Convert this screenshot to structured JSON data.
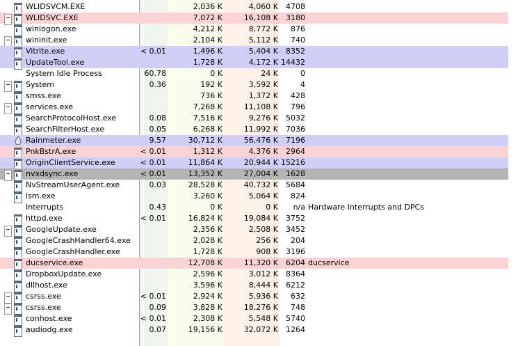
{
  "colors": {
    "highlight_pink": "#fbd3d6",
    "highlight_blue": "#cfcff8",
    "highlight_selected": "#b4b4b4",
    "cpu_column": "#eef6ee",
    "private_column": "#fcfcee",
    "working_set_column": "#fdf1ea"
  },
  "processes": [
    {
      "name": "WLIDSVCM.EXE",
      "cpu": "",
      "private": "2,036 K",
      "working_set": "4,060 K",
      "pid": "4708",
      "description": "",
      "tree": false,
      "icon": "window-icon",
      "highlight": ""
    },
    {
      "name": "WLIDSVC.EXE",
      "cpu": "",
      "private": "7,072 K",
      "working_set": "16,108 K",
      "pid": "3180",
      "description": "",
      "tree": true,
      "icon": "window-icon",
      "highlight": "pink"
    },
    {
      "name": "winlogon.exe",
      "cpu": "",
      "private": "4,212 K",
      "working_set": "8,772 K",
      "pid": "876",
      "description": "",
      "tree": false,
      "icon": "window-icon",
      "highlight": ""
    },
    {
      "name": "wininit.exe",
      "cpu": "",
      "private": "2,104 K",
      "working_set": "5,112 K",
      "pid": "740",
      "description": "",
      "tree": true,
      "icon": "window-icon",
      "highlight": ""
    },
    {
      "name": "Vitrite.exe",
      "cpu": "< 0.01",
      "private": "1,496 K",
      "working_set": "5,404 K",
      "pid": "8352",
      "description": "",
      "tree": false,
      "icon": "window-icon",
      "highlight": "blue"
    },
    {
      "name": "UpdateTool.exe",
      "cpu": "",
      "private": "1,728 K",
      "working_set": "4,172 K",
      "pid": "14432",
      "description": "",
      "tree": false,
      "icon": "window-icon",
      "highlight": "blue"
    },
    {
      "name": "System Idle Process",
      "cpu": "60.78",
      "private": "0 K",
      "working_set": "24 K",
      "pid": "0",
      "description": "",
      "tree": false,
      "icon": "",
      "highlight": ""
    },
    {
      "name": "System",
      "cpu": "0.36",
      "private": "192 K",
      "working_set": "3,592 K",
      "pid": "4",
      "description": "",
      "tree": true,
      "icon": "window-icon",
      "highlight": ""
    },
    {
      "name": "smss.exe",
      "cpu": "",
      "private": "736 K",
      "working_set": "1,372 K",
      "pid": "428",
      "description": "",
      "tree": false,
      "icon": "window-icon",
      "highlight": ""
    },
    {
      "name": "services.exe",
      "cpu": "",
      "private": "7,268 K",
      "working_set": "11,108 K",
      "pid": "796",
      "description": "",
      "tree": true,
      "icon": "window-icon",
      "highlight": ""
    },
    {
      "name": "SearchProtocolHost.exe",
      "cpu": "0.08",
      "private": "7,516 K",
      "working_set": "9,276 K",
      "pid": "5032",
      "description": "",
      "tree": false,
      "icon": "window-icon",
      "highlight": ""
    },
    {
      "name": "SearchFilterHost.exe",
      "cpu": "0.05",
      "private": "6,268 K",
      "working_set": "11,992 K",
      "pid": "7036",
      "description": "",
      "tree": false,
      "icon": "window-icon",
      "highlight": ""
    },
    {
      "name": "Rainmeter.exe",
      "cpu": "9.57",
      "private": "30,712 K",
      "working_set": "56,476 K",
      "pid": "7196",
      "description": "",
      "tree": false,
      "icon": "droplet-icon",
      "highlight": "blue"
    },
    {
      "name": "PnkBstrA.exe",
      "cpu": "< 0.01",
      "private": "1,312 K",
      "working_set": "4,376 K",
      "pid": "2964",
      "description": "",
      "tree": false,
      "icon": "window-icon",
      "highlight": "pink"
    },
    {
      "name": "OriginClientService.exe",
      "cpu": "< 0.01",
      "private": "11,864 K",
      "working_set": "20,944 K",
      "pid": "15216",
      "description": "",
      "tree": false,
      "icon": "window-icon",
      "highlight": "blue"
    },
    {
      "name": "nvxdsync.exe",
      "cpu": "< 0.01",
      "private": "13,352 K",
      "working_set": "27,004 K",
      "pid": "1628",
      "description": "",
      "tree": true,
      "icon": "window-icon",
      "highlight": "selected"
    },
    {
      "name": "NvStreamUserAgent.exe",
      "cpu": "0.03",
      "private": "28,528 K",
      "working_set": "40,732 K",
      "pid": "5684",
      "description": "",
      "tree": false,
      "icon": "window-icon",
      "highlight": ""
    },
    {
      "name": "lsm.exe",
      "cpu": "",
      "private": "3,260 K",
      "working_set": "5,064 K",
      "pid": "824",
      "description": "",
      "tree": false,
      "icon": "window-icon",
      "highlight": ""
    },
    {
      "name": "Interrupts",
      "cpu": "0.43",
      "private": "0 K",
      "working_set": "0 K",
      "pid": "n/a",
      "description": "Hardware Interrupts and DPCs",
      "tree": false,
      "icon": "",
      "highlight": ""
    },
    {
      "name": "httpd.exe",
      "cpu": "< 0.01",
      "private": "16,824 K",
      "working_set": "19,084 K",
      "pid": "3752",
      "description": "",
      "tree": false,
      "icon": "window-icon",
      "highlight": ""
    },
    {
      "name": "GoogleUpdate.exe",
      "cpu": "",
      "private": "2,356 K",
      "working_set": "2,508 K",
      "pid": "3452",
      "description": "",
      "tree": true,
      "icon": "window-icon",
      "highlight": ""
    },
    {
      "name": "GoogleCrashHandler64.exe",
      "cpu": "",
      "private": "2,028 K",
      "working_set": "256 K",
      "pid": "204",
      "description": "",
      "tree": false,
      "icon": "window-icon",
      "highlight": ""
    },
    {
      "name": "GoogleCrashHandler.exe",
      "cpu": "",
      "private": "1,728 K",
      "working_set": "908 K",
      "pid": "3196",
      "description": "",
      "tree": false,
      "icon": "window-icon",
      "highlight": ""
    },
    {
      "name": "ducservice.exe",
      "cpu": "",
      "private": "12,708 K",
      "working_set": "11,320 K",
      "pid": "6204",
      "description": "ducservice",
      "tree": false,
      "icon": "window-icon",
      "highlight": "pink"
    },
    {
      "name": "DropboxUpdate.exe",
      "cpu": "",
      "private": "2,596 K",
      "working_set": "3,012 K",
      "pid": "8364",
      "description": "",
      "tree": false,
      "icon": "window-icon",
      "highlight": ""
    },
    {
      "name": "dllhost.exe",
      "cpu": "",
      "private": "3,596 K",
      "working_set": "8,444 K",
      "pid": "6212",
      "description": "",
      "tree": false,
      "icon": "window-icon",
      "highlight": ""
    },
    {
      "name": "csrss.exe",
      "cpu": "< 0.01",
      "private": "2,924 K",
      "working_set": "5,936 K",
      "pid": "632",
      "description": "",
      "tree": true,
      "icon": "window-icon",
      "highlight": ""
    },
    {
      "name": "csrss.exe",
      "cpu": "0.09",
      "private": "3,828 K",
      "working_set": "18,276 K",
      "pid": "748",
      "description": "",
      "tree": true,
      "icon": "window-icon",
      "highlight": ""
    },
    {
      "name": "conhost.exe",
      "cpu": "< 0.01",
      "private": "2,308 K",
      "working_set": "5,548 K",
      "pid": "5740",
      "description": "",
      "tree": false,
      "icon": "window-icon",
      "highlight": ""
    },
    {
      "name": "audiodg.exe",
      "cpu": "0.07",
      "private": "19,156 K",
      "working_set": "32,072 K",
      "pid": "1264",
      "description": "",
      "tree": false,
      "icon": "window-icon",
      "highlight": ""
    }
  ]
}
